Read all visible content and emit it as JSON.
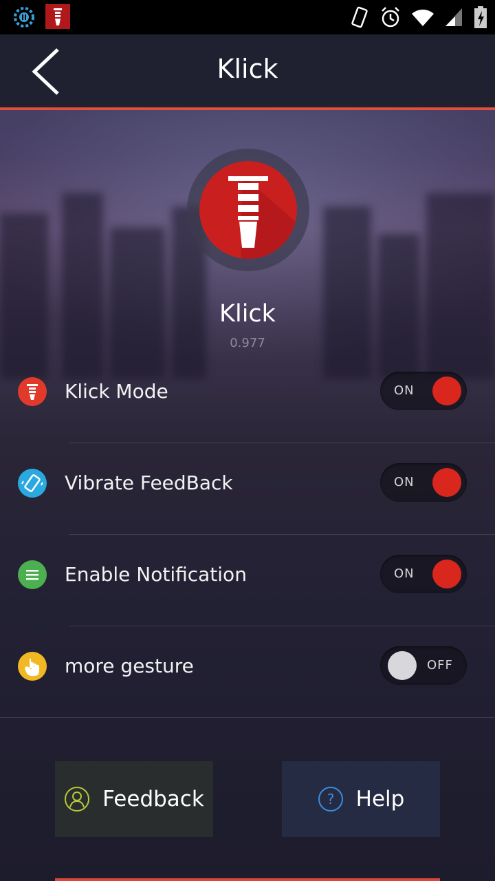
{
  "header": {
    "title": "Klick"
  },
  "app": {
    "name": "Klick",
    "version": "0.977"
  },
  "settings": [
    {
      "label": "Klick Mode",
      "state": "ON",
      "icon": "klick-icon",
      "color": "#e13a2a"
    },
    {
      "label": "Vibrate FeedBack",
      "state": "ON",
      "icon": "vibrate-icon",
      "color": "#2aa9e0"
    },
    {
      "label": "Enable Notification",
      "state": "ON",
      "icon": "notification-icon",
      "color": "#4caf50"
    },
    {
      "label": "more gesture",
      "state": "OFF",
      "icon": "gesture-icon",
      "color": "#f2b824"
    }
  ],
  "buttons": {
    "feedback": "Feedback",
    "help": "Help"
  },
  "colors": {
    "accent": "#d9271e",
    "underline": "#e0503c"
  }
}
